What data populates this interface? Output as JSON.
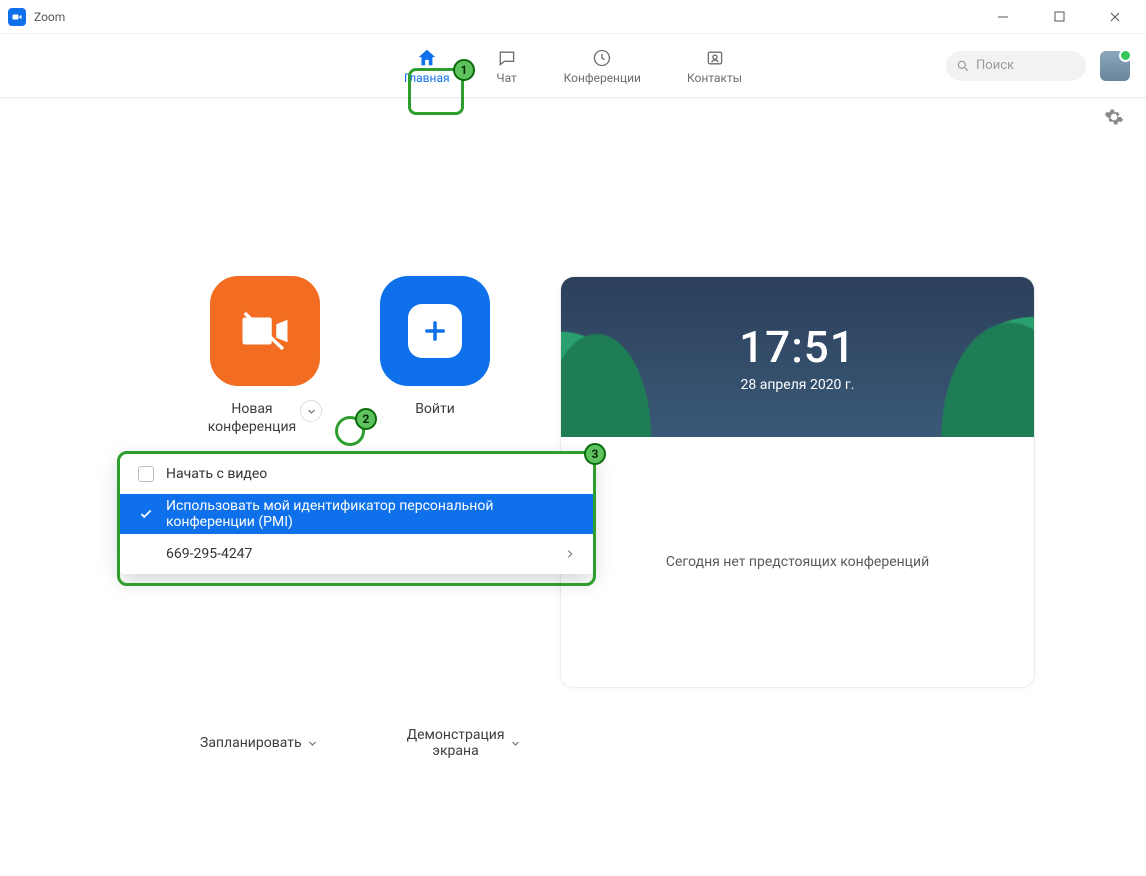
{
  "window": {
    "title": "Zoom"
  },
  "tabs": {
    "home": "Главная",
    "chat": "Чат",
    "meetings": "Конференции",
    "contacts": "Контакты"
  },
  "search": {
    "placeholder": "Поиск"
  },
  "tiles": {
    "new_meeting": "Новая\nконференция",
    "join": "Войти",
    "schedule": "Запланировать",
    "share": "Демонстрация\nэкрана"
  },
  "panel": {
    "time": "17:51",
    "date": "28 апреля 2020 г.",
    "empty_state": "Сегодня нет предстоящих конференций"
  },
  "dropdown": {
    "start_video": "Начать с видео",
    "use_pmi": "Использовать мой идентификатор персональной конференции (PMI)",
    "pmi_number": "669-295-4247"
  },
  "callouts": {
    "one": "1",
    "two": "2",
    "three": "3"
  }
}
